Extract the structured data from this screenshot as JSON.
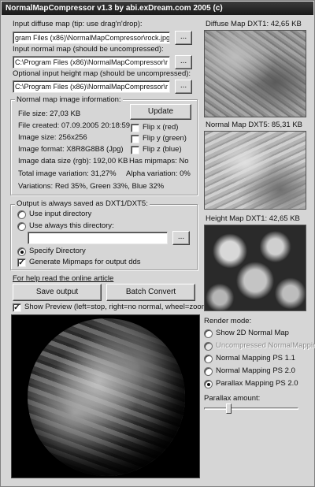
{
  "window": {
    "title": "NormalMapCompressor v1.3 by abi.exDream.com 2005 (c)"
  },
  "inputs": {
    "diffuse_label": "Input diffuse map (tip: use drag'n'drop):",
    "diffuse_value": "gram Files (x86)\\NormalMapCompressor\\rock.jpg",
    "normal_label": "Input normal map (should be uncompressed):",
    "normal_value": "C:\\Program Files (x86)\\NormalMapCompressor\\r",
    "height_label": "Optional input height map (should be uncompressed):",
    "height_value": "C:\\Program Files (x86)\\NormalMapCompressor\\r",
    "browse_label": "..."
  },
  "info": {
    "group_label": "Normal map image information:",
    "update_label": "Update",
    "file_size": "File size: 27,03 KB",
    "file_created": "File created: 07.09.2005 20:18:59",
    "image_size": "Image size: 256x256",
    "image_format": "Image format: X8R8G8B8 (Jpg)",
    "image_data_size": "Image data size (rgb): 192,00 KB",
    "flip_x": "Flip x (red)",
    "flip_y": "Flip y (green)",
    "flip_z": "Flip z (blue)",
    "has_mipmaps": "Has mipmaps: No",
    "total_variation": "Total image variation: 31,27%",
    "alpha_variation": "Alpha variation: 0%",
    "variations": "Variations: Red 35%, Green 33%, Blue 32%"
  },
  "output": {
    "group_label": "Output is always saved as DXT1/DXT5:",
    "use_input_dir": "Use input directory",
    "use_always_dir": "Use always this directory:",
    "dir_value": "",
    "specify_dir": "Specify Directory",
    "gen_mipmaps": "Generate Mipmaps for output dds"
  },
  "help_link": "For help read the online article",
  "save_label": "Save output",
  "batch_label": "Batch Convert",
  "show_preview": "Show Preview (left=stop, right=no normal, wheel=zoom)",
  "maps": {
    "diffuse": "Diffuse Map DXT1: 42,65 KB",
    "normal": "Normal Map DXT5: 85,31 KB",
    "height": "Height Map DXT1: 42,65 KB"
  },
  "render": {
    "label": "Render mode:",
    "opt1": "Show 2D Normal Map",
    "opt2": "Uncompressed NormalMapping",
    "opt3": "Normal Mapping PS 1.1",
    "opt4": "Normal Mapping PS 2.0",
    "opt5": "Parallax Mapping PS 2.0",
    "parallax_label": "Parallax amount:",
    "parallax_value": 0.25
  }
}
